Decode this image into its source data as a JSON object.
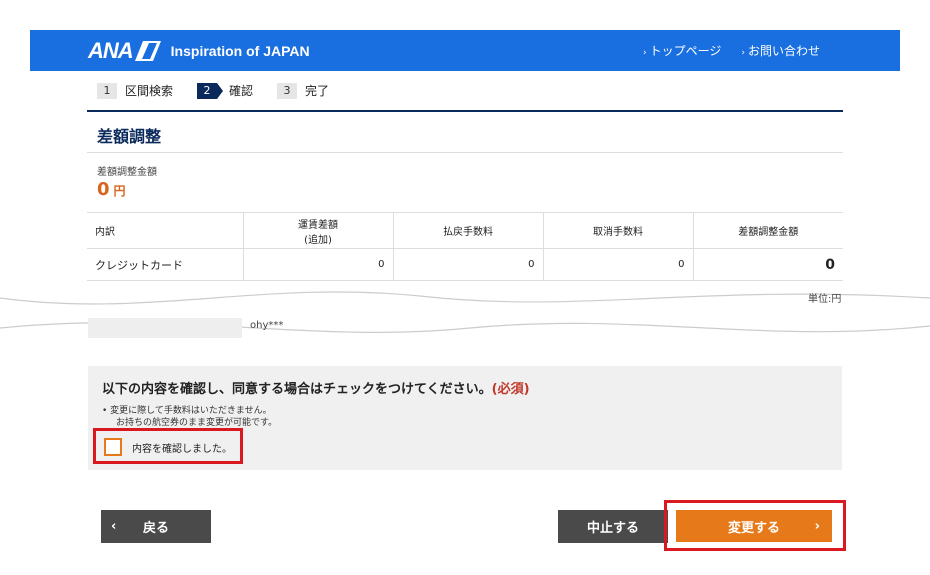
{
  "header": {
    "logo_text": "ANA",
    "tagline": "Inspiration of JAPAN",
    "links": [
      {
        "label": "トップページ"
      },
      {
        "label": "お問い合わせ"
      }
    ]
  },
  "steps": [
    {
      "num": "1",
      "label": "区間検索"
    },
    {
      "num": "2",
      "label": "確認"
    },
    {
      "num": "3",
      "label": "完了"
    }
  ],
  "section": {
    "title": "差額調整",
    "amount_label": "差額調整金額",
    "amount_value": "0",
    "amount_unit": "円"
  },
  "table": {
    "headers": [
      "内訳",
      "運賃差額",
      "(追加)",
      "払戻手数料",
      "取消手数料",
      "差額調整金額"
    ],
    "row": [
      "クレジットカード",
      "0",
      "0",
      "0",
      "0"
    ],
    "unit": "単位:円"
  },
  "masked": {
    "text": "ohy***"
  },
  "consent": {
    "title": "以下の内容を確認し、同意する場合はチェックをつけてください。",
    "required": "(必須)",
    "note1": "• 変更に際して手数料はいただきません。",
    "note2": "お持ちの航空券のまま変更が可能です。",
    "checkbox_label": "内容を確認しました。"
  },
  "buttons": {
    "back": "戻る",
    "stop": "中止する",
    "change": "変更する"
  },
  "colors": {
    "brand_blue": "#1a6fe0",
    "navy": "#0b2a5c",
    "accent_orange": "#e67a1a",
    "highlight_red": "#d9181f"
  }
}
